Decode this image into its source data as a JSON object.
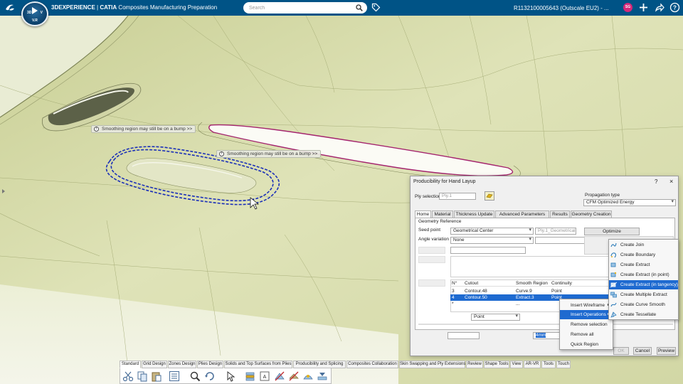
{
  "topbar": {
    "brand": "3DEXPERIENCE",
    "separator": " | ",
    "app": "CATIA",
    "app_module": "Composites Manufacturing Preparation",
    "search_placeholder": "Search",
    "context": "R1132100005643  (Outscale EU2) - ...",
    "avatar_initials": "SG",
    "compass": {
      "left": "3D",
      "right": "V",
      "version": "V.R"
    }
  },
  "viewport": {
    "annotations": [
      "Smoothing region may still be on a bump  >>",
      "Smoothing region may still be on a bump  >>"
    ]
  },
  "dialog": {
    "title": "Producibility for Hand Layup",
    "help": "?",
    "close": "×",
    "ply_selection_label": "Ply selection",
    "ply_selection_value": "Ply.1",
    "propagation_label": "Propagation type",
    "propagation_value": "CFM Optimized Energy",
    "tabs": [
      "Home",
      "Material",
      "Thickness Update",
      "Advanced Parameters",
      "Results",
      "Geometry Creation"
    ],
    "geometry_reference_label": "Geometry Reference",
    "seed_point_label": "Seed point",
    "seed_point_value": "Geometrical Center",
    "seed_point_ref": "Ply.1_GeometricalCer",
    "angle_variation_label": "Angle variation",
    "angle_variation_value": "None",
    "optimize_label": "Optimize",
    "table": {
      "headers": [
        "N°",
        "Cutout",
        "Smooth Region",
        "Continuity"
      ],
      "rows": [
        [
          "3",
          "Contour.48",
          "Curve.9",
          "Point"
        ],
        [
          "4",
          "Contour.50",
          "Extract.3",
          "Point"
        ],
        [
          "*",
          "",
          "...",
          ""
        ]
      ]
    },
    "continuity_value": "Point",
    "distance_value": "4mm",
    "ok_label": "OK",
    "cancel_label": "Cancel",
    "preview_label": "Preview"
  },
  "context_menu": {
    "items": [
      "Insert Wireframe",
      "Insert Operations",
      "Remove selection",
      "Remove all",
      "Quick Region"
    ]
  },
  "submenu": {
    "items": [
      {
        "label": "Create Join",
        "icon": "join-icon"
      },
      {
        "label": "Create Boundary",
        "icon": "boundary-icon"
      },
      {
        "label": "Create Extract",
        "icon": "extract-icon"
      },
      {
        "label": "Create Extract (in point)",
        "icon": "extract-point-icon"
      },
      {
        "label": "Create Extract (in tangency)",
        "icon": "extract-tangency-icon"
      },
      {
        "label": "Create Multiple Extract",
        "icon": "multiple-extract-icon"
      },
      {
        "label": "Create Curve Smooth",
        "icon": "curve-smooth-icon"
      },
      {
        "label": "Create Tessellate",
        "icon": "tessellate-icon"
      }
    ]
  },
  "action_bar": {
    "tabs": [
      "Standard",
      "Grid Design",
      "Zones Design",
      "Plies Design",
      "Solids and Top Surfaces from Plies",
      "Producibility and Splicing",
      "Composites Collaboration",
      "Skin Swapping and Ply Extensions",
      "Review",
      "Shape Tools",
      "View",
      "AR-VR",
      "Tools",
      "Touch"
    ],
    "active_tab": "Standard",
    "tools": [
      "cut-icon",
      "copy-icon",
      "paste-icon",
      "properties-icon",
      "zoom-icon",
      "update-icon",
      "select-icon",
      "ply-group-icon",
      "ply-icon",
      "drop-off-icon",
      "core-icon",
      "producibility-icon",
      "flatten-icon"
    ]
  },
  "colors": {
    "topbar": "#005386",
    "surface": "#d5d9a4",
    "selection": "#1e6ad0",
    "cutout_edge": "#a4246e",
    "region_dash": "#1a2fb8"
  }
}
